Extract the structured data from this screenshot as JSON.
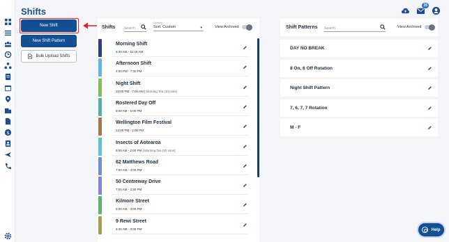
{
  "page": {
    "title": "Shifts"
  },
  "header": {
    "notification_count": "35"
  },
  "nav": {
    "icons": [
      "dashboard-icon",
      "list-icon",
      "team-icon",
      "clock-icon",
      "org-chart-icon",
      "document-icon",
      "calendar-icon",
      "location-icon",
      "building-icon",
      "file-icon",
      "dollar-icon",
      "id-card-icon",
      "plane-icon",
      "phone-icon",
      "settings-icon"
    ]
  },
  "actions": {
    "new_shift": "New Shift",
    "new_shift_pattern": "New Shift Pattern",
    "bulk_upload": "Bulk Upload Shifts"
  },
  "shifts_panel": {
    "title": "Shifts",
    "search_placeholder": "Search",
    "sort_label": "Sorting",
    "sort_value": "Sort: Custom",
    "archived_label": "View Archived",
    "items": [
      {
        "name": "Morning Shift",
        "time": "6:30 AM - 11:00 AM",
        "note": "",
        "color": "#2e3f8c"
      },
      {
        "name": "Afternoon Shift",
        "time": "4:00 PM - 7:00 PM",
        "note": "",
        "color": "#62b4f2"
      },
      {
        "name": "Night Shift",
        "time": "10:00 PM - 7:00 AM |",
        "note": "Morning Tea (10 mins)",
        "color": "#7fbf58"
      },
      {
        "name": "Rostered Day Off",
        "time": "8:00 AM - 5:00 PM",
        "note": "",
        "color": "#4fb3a6"
      },
      {
        "name": "Wellington Film Festival",
        "time": "12:00 PM - 2:00 PM",
        "note": "",
        "color": "#9c7a4e"
      },
      {
        "name": "Insects of Aotearoa",
        "time": "8:00 AM - 2:00 PM |",
        "note": "Morning Tea (10 mins)",
        "color": "#56c6d6"
      },
      {
        "name": "62 Matthews Road",
        "time": "7:00 AM - 4:00 PM",
        "note": "",
        "color": "#6b8fe0"
      },
      {
        "name": "50 Centreway Drive",
        "time": "7:00 AM - 2:30 PM",
        "note": "",
        "color": "#7d80e6"
      },
      {
        "name": "Kilmore Street",
        "time": "6:00 AM - 3:00 PM",
        "note": "",
        "color": "#58b46a"
      },
      {
        "name": "9 Rewi Street",
        "time": "6:30 AM - 3:00 PM",
        "note": "",
        "color": "#a5a04c"
      }
    ]
  },
  "patterns_panel": {
    "title": "Shift Patterns",
    "search_placeholder": "Search",
    "archived_label": "View Archived",
    "items": [
      {
        "name": "DAY NO BREAK"
      },
      {
        "name": "8 On, 6 Off Rotation"
      },
      {
        "name": "Night Shift Pattern"
      },
      {
        "name": "7, 6, 7, 7 Rotation"
      },
      {
        "name": "M - F"
      }
    ]
  },
  "help": {
    "label": "Help"
  },
  "colors": {
    "brand": "#134f93",
    "title": "#1e4e8c",
    "highlight": "#e0262b"
  }
}
